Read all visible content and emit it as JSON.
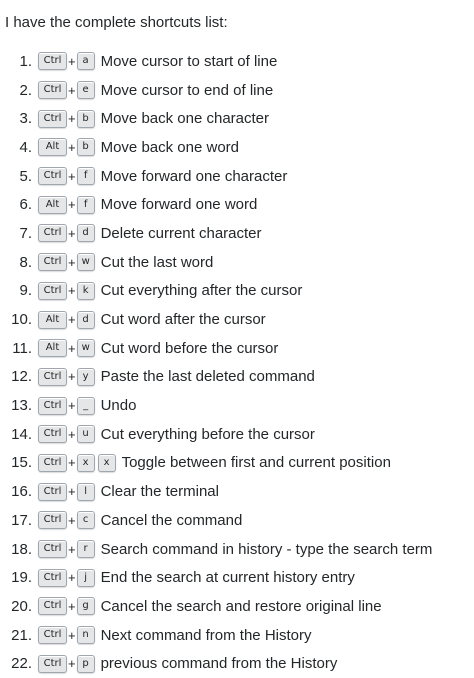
{
  "intro": "I have the complete shortcuts list:",
  "shortcuts": [
    {
      "num": "1.",
      "mod": "Ctrl",
      "keys": [
        "a"
      ],
      "desc": "Move cursor to start of line"
    },
    {
      "num": "2.",
      "mod": "Ctrl",
      "keys": [
        "e"
      ],
      "desc": "Move cursor to end of line"
    },
    {
      "num": "3.",
      "mod": "Ctrl",
      "keys": [
        "b"
      ],
      "desc": "Move back one character"
    },
    {
      "num": "4.",
      "mod": "Alt",
      "keys": [
        "b"
      ],
      "desc": "Move back one word"
    },
    {
      "num": "5.",
      "mod": "Ctrl",
      "keys": [
        "f"
      ],
      "desc": "Move forward one character"
    },
    {
      "num": "6.",
      "mod": "Alt",
      "keys": [
        "f"
      ],
      "desc": "Move forward one word"
    },
    {
      "num": "7.",
      "mod": "Ctrl",
      "keys": [
        "d"
      ],
      "desc": "Delete current character"
    },
    {
      "num": "8.",
      "mod": "Ctrl",
      "keys": [
        "w"
      ],
      "desc": "Cut the last word"
    },
    {
      "num": "9.",
      "mod": "Ctrl",
      "keys": [
        "k"
      ],
      "desc": "Cut everything after the cursor"
    },
    {
      "num": "10.",
      "mod": "Alt",
      "keys": [
        "d"
      ],
      "desc": "Cut word after the cursor"
    },
    {
      "num": "11.",
      "mod": "Alt",
      "keys": [
        "w"
      ],
      "desc": "Cut word before the cursor"
    },
    {
      "num": "12.",
      "mod": "Ctrl",
      "keys": [
        "y"
      ],
      "desc": "Paste the last deleted command"
    },
    {
      "num": "13.",
      "mod": "Ctrl",
      "keys": [
        "_"
      ],
      "desc": "Undo"
    },
    {
      "num": "14.",
      "mod": "Ctrl",
      "keys": [
        "u"
      ],
      "desc": "Cut everything before the cursor"
    },
    {
      "num": "15.",
      "mod": "Ctrl",
      "keys": [
        "x",
        "x"
      ],
      "desc": "Toggle between first and current position"
    },
    {
      "num": "16.",
      "mod": "Ctrl",
      "keys": [
        "l"
      ],
      "desc": "Clear the terminal"
    },
    {
      "num": "17.",
      "mod": "Ctrl",
      "keys": [
        "c"
      ],
      "desc": "Cancel the command"
    },
    {
      "num": "18.",
      "mod": "Ctrl",
      "keys": [
        "r"
      ],
      "desc": "Search command in history - type the search term"
    },
    {
      "num": "19.",
      "mod": "Ctrl",
      "keys": [
        "j"
      ],
      "desc": "End the search at current history entry"
    },
    {
      "num": "20.",
      "mod": "Ctrl",
      "keys": [
        "g"
      ],
      "desc": "Cancel the search and restore original line"
    },
    {
      "num": "21.",
      "mod": "Ctrl",
      "keys": [
        "n"
      ],
      "desc": "Next command from the History"
    },
    {
      "num": "22.",
      "mod": "Ctrl",
      "keys": [
        "p"
      ],
      "desc": "previous command from the History"
    }
  ],
  "plus_sign": "+",
  "colors": {
    "text": "#242729",
    "kbd_bg": "#e4e6e8",
    "kbd_border": "#9fa6ad"
  }
}
